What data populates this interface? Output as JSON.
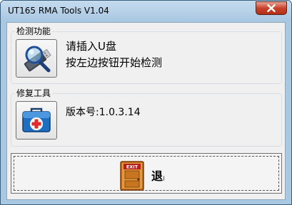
{
  "window": {
    "title": "UT165 RMA Tools  V1.04"
  },
  "detect_group": {
    "legend": "检测功能",
    "icon": "usb-drive-magnifier-icon",
    "line1": "请插入U盘",
    "line2": "按左边按钮开始检测"
  },
  "repair_group": {
    "legend": "修复工具",
    "icon": "first-aid-kit-icon",
    "version_text": "版本号:1.0.3.14"
  },
  "exit_button": {
    "icon": "exit-door-icon",
    "icon_text": "EXIT",
    "label": "退出"
  }
}
